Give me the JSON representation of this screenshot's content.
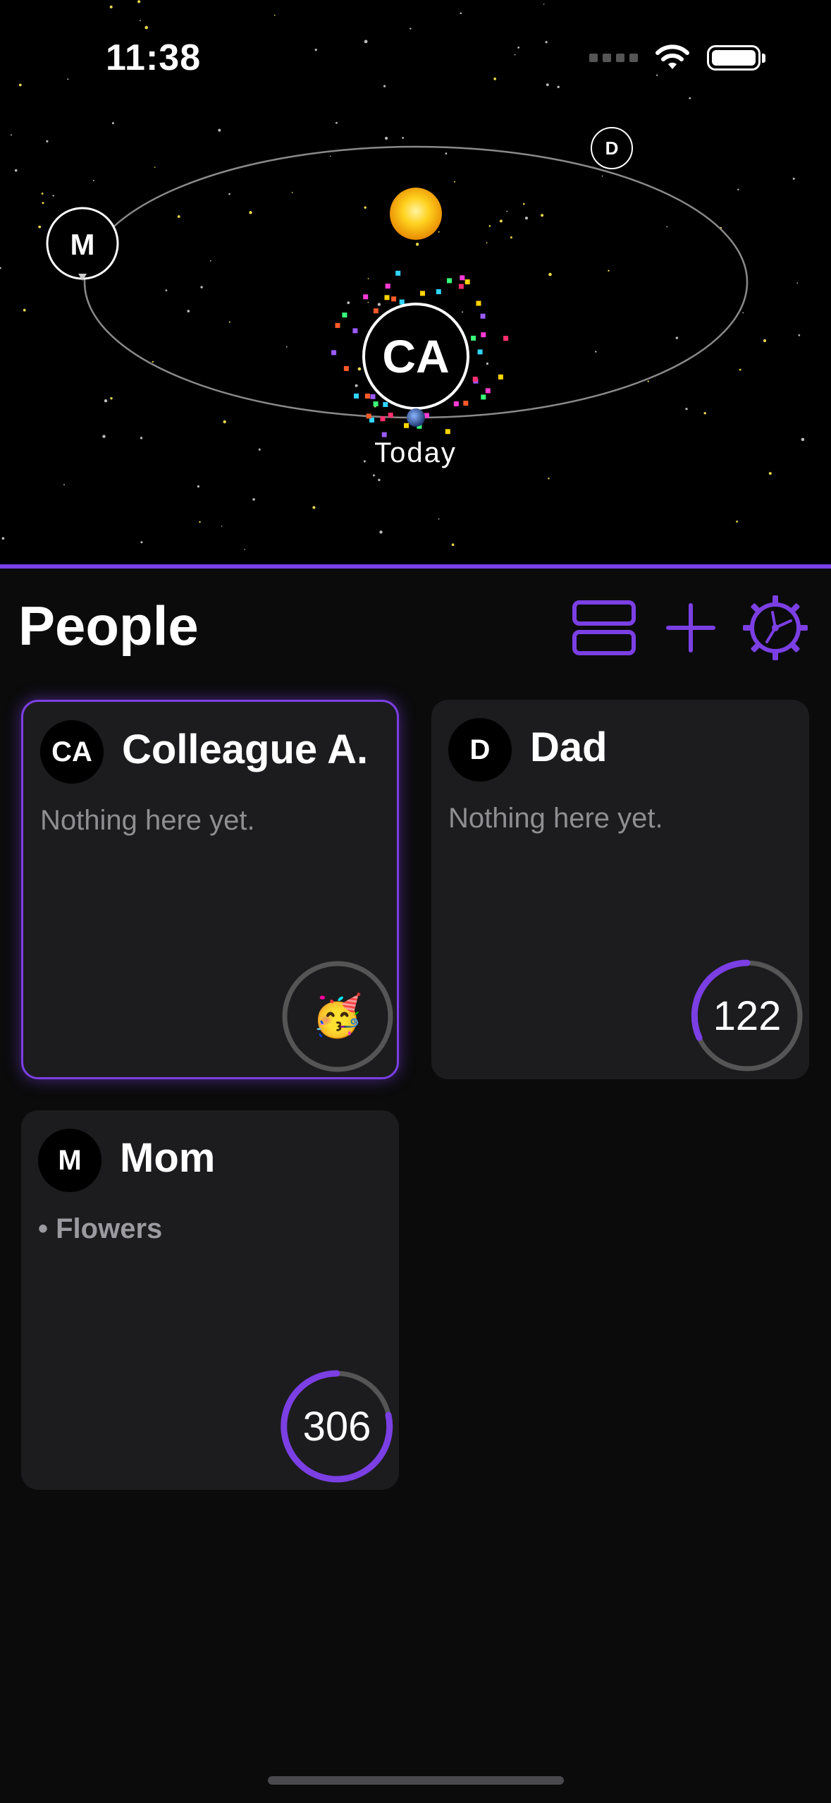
{
  "status_bar": {
    "time": "11:38"
  },
  "orbit": {
    "center_label": "Today",
    "planet_labels": [
      "M",
      "D",
      "CA"
    ]
  },
  "header": {
    "title": "People"
  },
  "people": [
    {
      "initials": "CA",
      "name": "Colleague A.",
      "note": "Nothing here yet.",
      "ring_value": "",
      "ring_emoji": "🥳",
      "selected": true
    },
    {
      "initials": "D",
      "name": "Dad",
      "note": "Nothing here yet.",
      "ring_value": "122"
    },
    {
      "initials": "M",
      "name": "Mom",
      "note": "• Flowers",
      "ring_value": "306"
    }
  ],
  "colors": {
    "accent": "#7b3fe4",
    "card": "#1c1c1e",
    "background": "#0b0b0c"
  }
}
